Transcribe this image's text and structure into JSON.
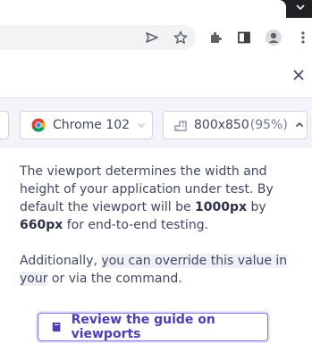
{
  "browser_selector": {
    "label": "Chrome 102"
  },
  "viewport_selector": {
    "size": "800x850",
    "scale": "(95%)"
  },
  "popover": {
    "para1_part1": "The viewport determines the width and height of your application under test. By default the viewport will be ",
    "width_value": "1000px",
    "by_text": " by ",
    "height_value": "660px",
    "para1_part3": " for end-to-end testing.",
    "para2_part1": "Additionally, ",
    "para2_highlight": "you can override this value in your",
    "para2_part3": " or via the command.",
    "guide_button_label": "Review the guide on viewports"
  },
  "colors": {
    "accent": "#4b3fb5",
    "chrome_frame": "#202124",
    "panel_bg": "#f3f4fa"
  }
}
